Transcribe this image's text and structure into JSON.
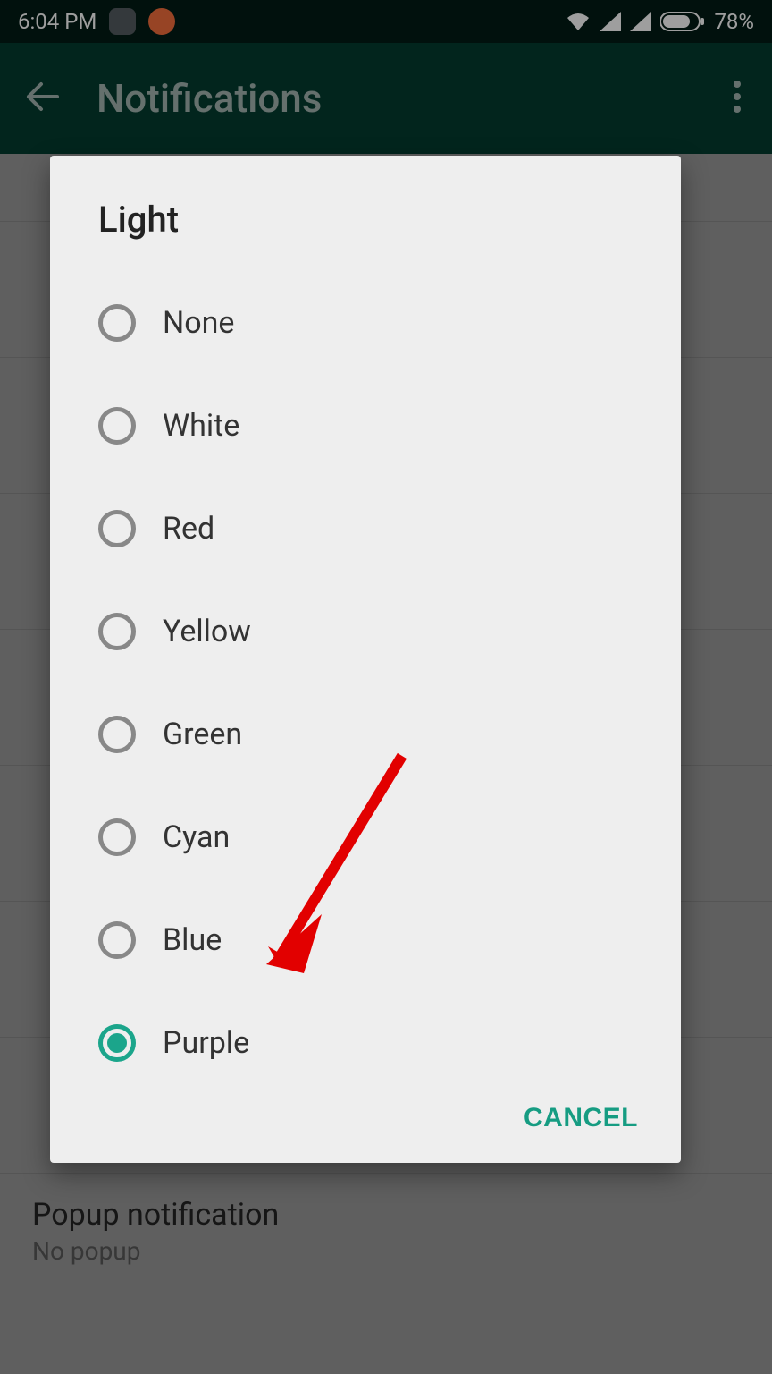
{
  "statusbar": {
    "time": "6:04 PM",
    "battery": "78%"
  },
  "appbar": {
    "title": "Notifications"
  },
  "dialog": {
    "title": "Light",
    "options": [
      "None",
      "White",
      "Red",
      "Yellow",
      "Green",
      "Cyan",
      "Blue",
      "Purple"
    ],
    "selected_index": 7,
    "cancel": "CANCEL"
  },
  "background_rows": [
    {
      "label": "Popup notification",
      "sub": "No popup"
    }
  ],
  "colors": {
    "accent": "#169c82",
    "appbar_bg": "#043d30"
  }
}
